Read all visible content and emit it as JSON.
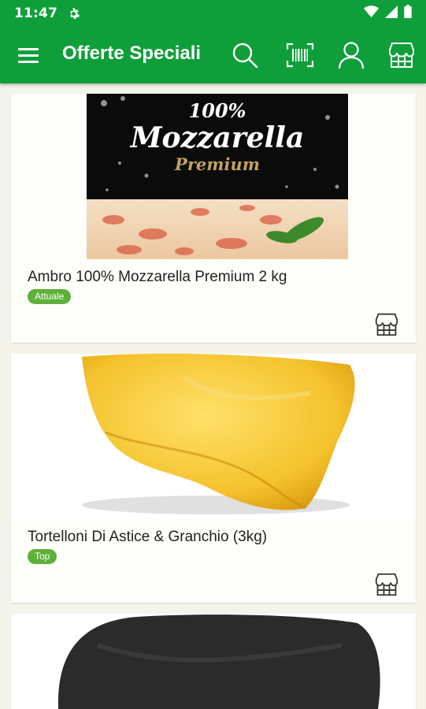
{
  "status_bar": {
    "time": "11:47",
    "icons": [
      "gear-icon",
      "wifi-icon",
      "signal-icon",
      "battery-icon"
    ]
  },
  "app_bar": {
    "title": "Offerte Speciali",
    "actions": [
      "search-icon",
      "barcode-scanner-icon",
      "user-icon",
      "store-icon"
    ],
    "background": "#0e9f3a"
  },
  "products": [
    {
      "name": "Ambro 100% Mozzarella Premium 2 kg",
      "badge": "Attuale",
      "image": {
        "line1": "100%",
        "line2": "Mozzarella",
        "line3": "Premium"
      }
    },
    {
      "name": "Tortelloni Di Astice & Granchio (3kg)",
      "badge": "Top"
    },
    {
      "name": "",
      "badge": ""
    }
  ],
  "colors": {
    "accent": "#0e9f3a",
    "badge": "#5fb03a",
    "background": "#f4f4ea"
  }
}
